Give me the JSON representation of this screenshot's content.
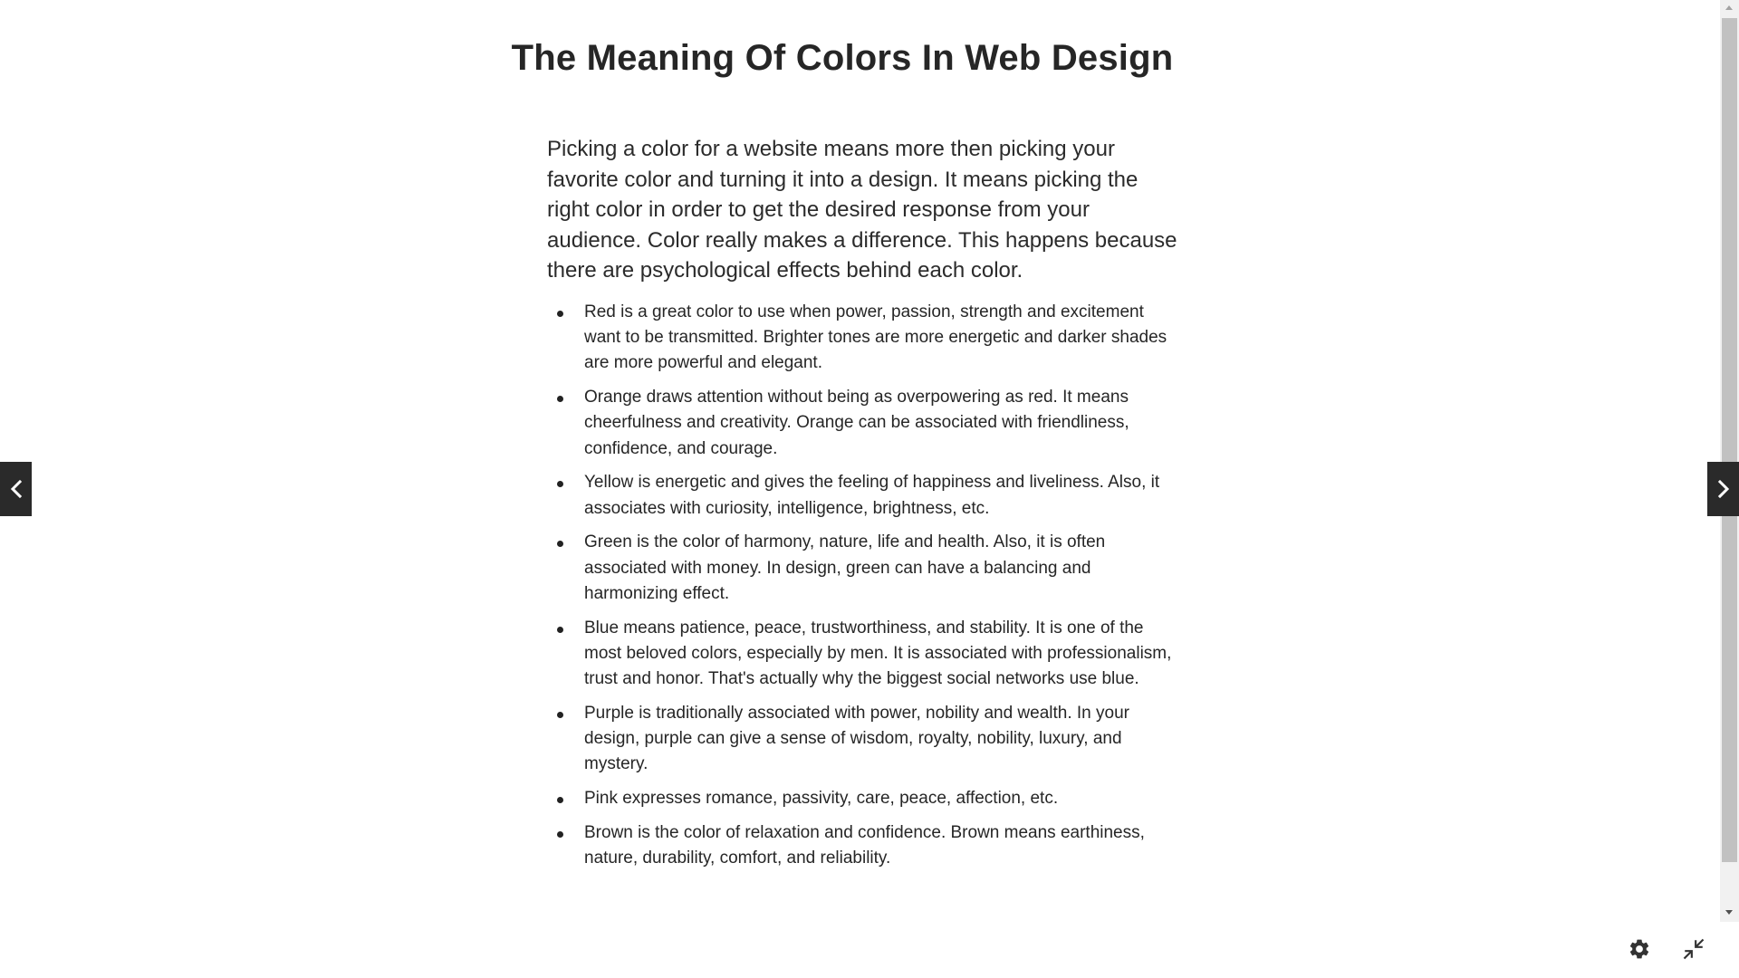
{
  "article": {
    "title": "The Meaning Of Colors In Web Design",
    "intro": "Picking a color for a website means more then picking your favorite color and turning it into a design. It means picking the right color in order to get the desired response from your audience. Color really makes a difference. This happens because there are psychological effects behind each color.",
    "items": [
      "Red is a great color to use when power, passion, strength and excitement want to be transmitted. Brighter tones are more energetic and darker shades are more powerful and elegant.",
      "Orange draws attention without being as overpowering as red. It means cheerfulness and creativity. Orange can be associated with friendliness, confidence, and courage.",
      "Yellow is energetic and gives the feeling of happiness and liveliness. Also, it associates with curiosity, intelligence, brightness, etc.",
      "Green is the color of harmony, nature, life and health. Also, it is often associated with money. In design, green can have a balancing and harmonizing effect.",
      "Blue means patience, peace, trustworthiness, and stability. It is one of the most beloved colors, especially by men. It is associated with professionalism, trust and honor. That's actually why the biggest social networks use blue.",
      "Purple is traditionally associated with power, nobility and wealth. In your design, purple can give a sense of wisdom, royalty, nobility, luxury, and mystery.",
      "Pink expresses romance, passivity, care, peace, affection, etc.",
      "Brown is the color of relaxation and confidence. Brown means earthiness, nature, durability, comfort, and reliability."
    ]
  },
  "navigation": {
    "prev_icon": "chevron-left-icon",
    "next_icon": "chevron-right-icon"
  },
  "toolbar": {
    "settings_icon": "gear-icon",
    "exit_fullscreen_icon": "exit-fullscreen-icon"
  },
  "colors": {
    "text": "#2b2b2b",
    "nav_button_bg": "#2a2a2a",
    "scrollbar_thumb": "#c1c1c1",
    "scrollbar_track": "#f1f1f1",
    "toolbar_icon": "#333333"
  }
}
